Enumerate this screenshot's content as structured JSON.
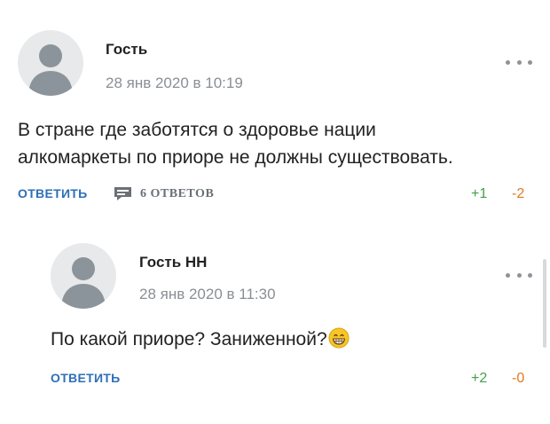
{
  "comments": [
    {
      "author": "Гость",
      "date": "28 янв 2020 в 10:19",
      "text_lines": [
        "В стране где заботятся о здоровье нации",
        "алкомаркеты по приоре не должны существовать."
      ],
      "reply_label": "ОТВЕТИТЬ",
      "replies_label": "6 ОТВЕТОВ",
      "upvotes": "+1",
      "downvotes": "-2"
    },
    {
      "author": "Гость НН",
      "date": "28 янв 2020 в 11:30",
      "text": "По какой приоре? Заниженной?",
      "emoji": "grinning-face-emoji",
      "reply_label": "ОТВЕТИТЬ",
      "upvotes": "+2",
      "downvotes": "-0"
    }
  ],
  "icons": {
    "more": "more-dots-icon",
    "replies": "comment-bubble-icon",
    "avatar": "default-user-icon"
  },
  "colors": {
    "link_blue": "#2d6fb6",
    "upvote_green": "#43a047",
    "downvote_orange": "#e07a1f",
    "muted_gray": "#8a8f94"
  }
}
